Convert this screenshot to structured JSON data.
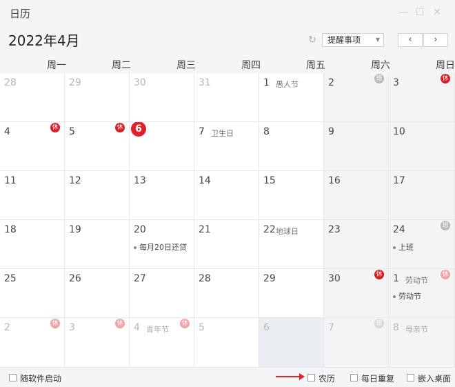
{
  "window": {
    "title": "日历"
  },
  "header": {
    "month_title": "2022年4月",
    "reminder_select": "提醒事项",
    "prev": "‹",
    "next": "›"
  },
  "weekdays": [
    "周一",
    "周二",
    "周三",
    "周四",
    "周五",
    "周六",
    "周日"
  ],
  "weeks": [
    [
      {
        "n": "28",
        "dim": true
      },
      {
        "n": "29",
        "dim": true
      },
      {
        "n": "30",
        "dim": true
      },
      {
        "n": "31",
        "dim": true
      },
      {
        "n": "1",
        "hol": "愚人节"
      },
      {
        "n": "2",
        "badge": "班",
        "badge_style": "grey"
      },
      {
        "n": "3",
        "badge": "休",
        "badge_style": "red"
      }
    ],
    [
      {
        "n": "4",
        "badge": "休",
        "badge_style": "red"
      },
      {
        "n": "5",
        "badge": "休",
        "badge_style": "red"
      },
      {
        "n": "6",
        "today": true
      },
      {
        "n": "7",
        "hol": "卫生日"
      },
      {
        "n": "8"
      },
      {
        "n": "9"
      },
      {
        "n": "10"
      }
    ],
    [
      {
        "n": "11"
      },
      {
        "n": "12"
      },
      {
        "n": "13"
      },
      {
        "n": "14"
      },
      {
        "n": "15"
      },
      {
        "n": "16"
      },
      {
        "n": "17"
      }
    ],
    [
      {
        "n": "18"
      },
      {
        "n": "19"
      },
      {
        "n": "20",
        "event": "每月20日还贷"
      },
      {
        "n": "21"
      },
      {
        "n": "22",
        "hol": "地球日"
      },
      {
        "n": "23"
      },
      {
        "n": "24",
        "badge": "班",
        "badge_style": "grey",
        "event": "上班"
      }
    ],
    [
      {
        "n": "25"
      },
      {
        "n": "26"
      },
      {
        "n": "27"
      },
      {
        "n": "28"
      },
      {
        "n": "29"
      },
      {
        "n": "30",
        "badge": "休",
        "badge_style": "red"
      },
      {
        "n": "1",
        "hol": "劳动节",
        "badge": "休",
        "badge_style": "light",
        "event": "劳动节"
      }
    ],
    [
      {
        "n": "2",
        "dim": true,
        "badge": "休",
        "badge_style": "light"
      },
      {
        "n": "3",
        "dim": true,
        "badge": "休",
        "badge_style": "light"
      },
      {
        "n": "4",
        "dim": true,
        "hol": "青年节",
        "badge": "休",
        "badge_style": "light"
      },
      {
        "n": "5",
        "dim": true
      },
      {
        "n": "6",
        "dim": true,
        "selected": true
      },
      {
        "n": "7",
        "dim": true,
        "badge": "班",
        "badge_style": "pale"
      },
      {
        "n": "8",
        "dim": true,
        "hol": "母亲节"
      }
    ]
  ],
  "footer": {
    "autostart": "随软件启动",
    "lunar": "农历",
    "daily_repeat": "每日重复",
    "embed_desktop": "嵌入桌面"
  },
  "colors": {
    "accent": "#e0202b",
    "weekend_bg": "#f4f4f6"
  }
}
